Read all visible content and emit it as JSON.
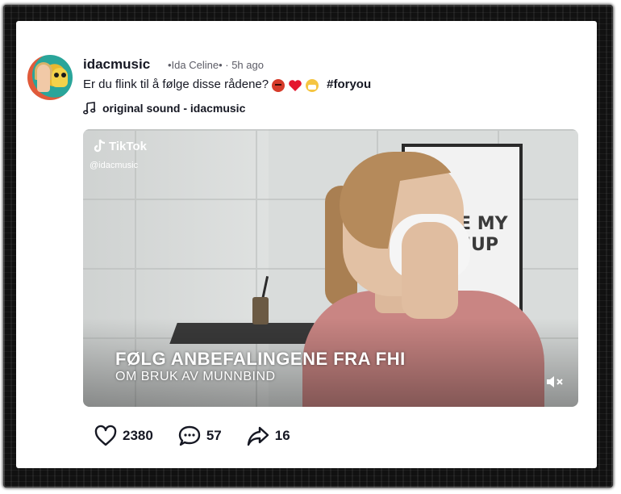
{
  "post": {
    "username": "idacmusic",
    "display_meta": "•Ida Celine• · 5h ago",
    "caption_text": "Er du flink til å følge disse rådene?",
    "caption_emojis": [
      "angry-face-emoji",
      "red-heart-emoji",
      "mask-face-emoji"
    ],
    "hashtag": "#foryou",
    "sound": "original sound - idacmusic"
  },
  "video": {
    "watermark_brand": "TikTok",
    "watermark_handle": "@idacmusic",
    "subtitle_line1": "FØLG ANBEFALINGENE FRA FHI",
    "subtitle_line2": "OM BRUK AV MUNNBIND",
    "poster_text_line1": "E MY",
    "poster_text_line2": "EUP",
    "muted": true
  },
  "stats": {
    "likes": "2380",
    "comments": "57",
    "shares": "16"
  },
  "colors": {
    "frame": "#111111",
    "text": "#161823",
    "heart": "#e4162e"
  }
}
